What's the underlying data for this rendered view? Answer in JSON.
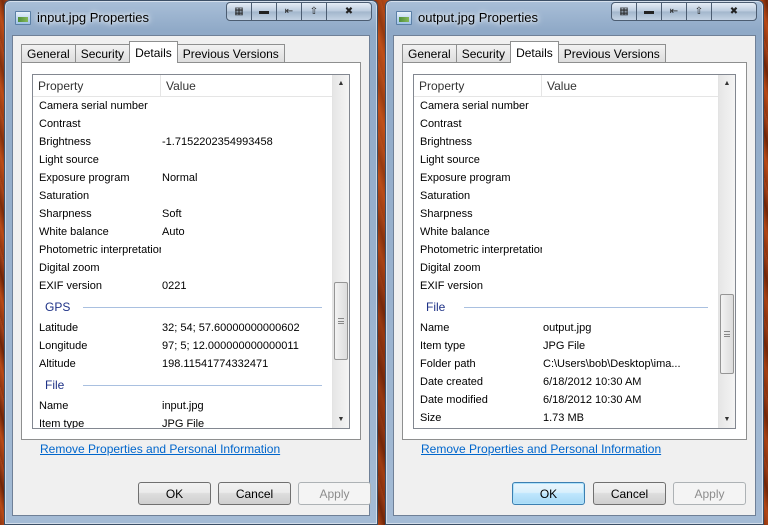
{
  "left_window": {
    "title": "input.jpg Properties",
    "tabs": [
      "General",
      "Security",
      "Details",
      "Previous Versions"
    ],
    "active_tab": "Details",
    "columns": {
      "property": "Property",
      "value": "Value"
    },
    "rows": [
      {
        "k": "Camera serial number",
        "v": ""
      },
      {
        "k": "Contrast",
        "v": ""
      },
      {
        "k": "Brightness",
        "v": "-1.7152202354993458"
      },
      {
        "k": "Light source",
        "v": ""
      },
      {
        "k": "Exposure program",
        "v": "Normal"
      },
      {
        "k": "Saturation",
        "v": ""
      },
      {
        "k": "Sharpness",
        "v": "Soft"
      },
      {
        "k": "White balance",
        "v": "Auto"
      },
      {
        "k": "Photometric interpretation",
        "v": ""
      },
      {
        "k": "Digital zoom",
        "v": ""
      },
      {
        "k": "EXIF version",
        "v": "0221"
      }
    ],
    "group_gps": "GPS",
    "gps_rows": [
      {
        "k": "Latitude",
        "v": "32; 54; 57.60000000000602"
      },
      {
        "k": "Longitude",
        "v": "97; 5; 12.000000000000011"
      },
      {
        "k": "Altitude",
        "v": "198.11541774332471"
      }
    ],
    "group_file": "File",
    "file_rows": [
      {
        "k": "Name",
        "v": "input.jpg"
      },
      {
        "k": "Item type",
        "v": "JPG File"
      }
    ],
    "remove_link": "Remove Properties and Personal Information",
    "buttons": {
      "ok": "OK",
      "cancel": "Cancel",
      "apply": "Apply"
    }
  },
  "right_window": {
    "title": "output.jpg Properties",
    "tabs": [
      "General",
      "Security",
      "Details",
      "Previous Versions"
    ],
    "active_tab": "Details",
    "columns": {
      "property": "Property",
      "value": "Value"
    },
    "rows": [
      {
        "k": "Camera serial number",
        "v": ""
      },
      {
        "k": "Contrast",
        "v": ""
      },
      {
        "k": "Brightness",
        "v": ""
      },
      {
        "k": "Light source",
        "v": ""
      },
      {
        "k": "Exposure program",
        "v": ""
      },
      {
        "k": "Saturation",
        "v": ""
      },
      {
        "k": "Sharpness",
        "v": ""
      },
      {
        "k": "White balance",
        "v": ""
      },
      {
        "k": "Photometric interpretation",
        "v": ""
      },
      {
        "k": "Digital zoom",
        "v": ""
      },
      {
        "k": "EXIF version",
        "v": ""
      }
    ],
    "group_file": "File",
    "file_rows": [
      {
        "k": "Name",
        "v": "output.jpg"
      },
      {
        "k": "Item type",
        "v": "JPG File"
      },
      {
        "k": "Folder path",
        "v": "C:\\Users\\bob\\Desktop\\ima..."
      },
      {
        "k": "Date created",
        "v": "6/18/2012 10:30 AM"
      },
      {
        "k": "Date modified",
        "v": "6/18/2012 10:30 AM"
      },
      {
        "k": "Size",
        "v": "1.73 MB"
      }
    ],
    "remove_link": "Remove Properties and Personal Information",
    "buttons": {
      "ok": "OK",
      "cancel": "Cancel",
      "apply": "Apply"
    }
  },
  "icons": [
    "image-file-icon",
    "minimize-icon",
    "maximize-icon",
    "restore-icon",
    "close-icon",
    "scroll-up-icon",
    "scroll-down-icon"
  ]
}
